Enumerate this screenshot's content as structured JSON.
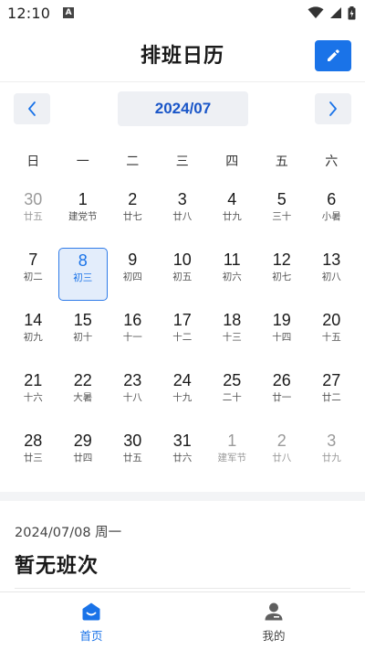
{
  "status_bar": {
    "time": "12:10",
    "notification_badge": "A"
  },
  "app_bar": {
    "title": "排班日历",
    "edit_icon": "pencil-icon"
  },
  "month_nav": {
    "label": "2024/07",
    "prev_icon": "chevron-left-icon",
    "next_icon": "chevron-right-icon"
  },
  "weekdays": [
    "日",
    "一",
    "二",
    "三",
    "四",
    "五",
    "六"
  ],
  "calendar": {
    "weeks": [
      [
        {
          "day": "30",
          "lunar": "廿五",
          "other_month": true
        },
        {
          "day": "1",
          "lunar": "建党节"
        },
        {
          "day": "2",
          "lunar": "廿七"
        },
        {
          "day": "3",
          "lunar": "廿八"
        },
        {
          "day": "4",
          "lunar": "廿九"
        },
        {
          "day": "5",
          "lunar": "三十"
        },
        {
          "day": "6",
          "lunar": "小暑"
        }
      ],
      [
        {
          "day": "7",
          "lunar": "初二"
        },
        {
          "day": "8",
          "lunar": "初三",
          "selected": true
        },
        {
          "day": "9",
          "lunar": "初四"
        },
        {
          "day": "10",
          "lunar": "初五"
        },
        {
          "day": "11",
          "lunar": "初六"
        },
        {
          "day": "12",
          "lunar": "初七"
        },
        {
          "day": "13",
          "lunar": "初八"
        }
      ],
      [
        {
          "day": "14",
          "lunar": "初九"
        },
        {
          "day": "15",
          "lunar": "初十"
        },
        {
          "day": "16",
          "lunar": "十一"
        },
        {
          "day": "17",
          "lunar": "十二"
        },
        {
          "day": "18",
          "lunar": "十三"
        },
        {
          "day": "19",
          "lunar": "十四"
        },
        {
          "day": "20",
          "lunar": "十五"
        }
      ],
      [
        {
          "day": "21",
          "lunar": "十六"
        },
        {
          "day": "22",
          "lunar": "大暑"
        },
        {
          "day": "23",
          "lunar": "十八"
        },
        {
          "day": "24",
          "lunar": "十九"
        },
        {
          "day": "25",
          "lunar": "二十"
        },
        {
          "day": "26",
          "lunar": "廿一"
        },
        {
          "day": "27",
          "lunar": "廿二"
        }
      ],
      [
        {
          "day": "28",
          "lunar": "廿三"
        },
        {
          "day": "29",
          "lunar": "廿四"
        },
        {
          "day": "30",
          "lunar": "廿五"
        },
        {
          "day": "31",
          "lunar": "廿六"
        },
        {
          "day": "1",
          "lunar": "建军节",
          "other_month": true
        },
        {
          "day": "2",
          "lunar": "廿八",
          "other_month": true
        },
        {
          "day": "3",
          "lunar": "廿九",
          "other_month": true
        }
      ]
    ]
  },
  "selected_day": {
    "date_text": "2024/07/08 周一",
    "shift_text": "暂无班次"
  },
  "bottom_nav": {
    "items": [
      {
        "label": "首页",
        "icon": "home-icon",
        "active": true
      },
      {
        "label": "我的",
        "icon": "profile-icon",
        "active": false
      }
    ]
  },
  "colors": {
    "accent": "#1a73e8",
    "selected_bg": "#e3edfb",
    "nav_btn_bg": "#eef0f4",
    "muted_text": "#9a9a9a"
  }
}
